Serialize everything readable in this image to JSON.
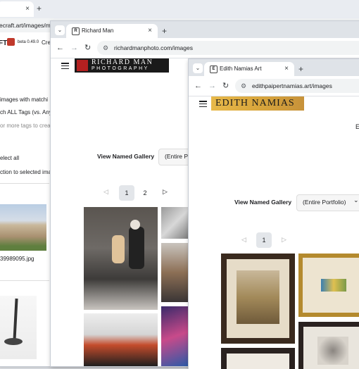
{
  "win1": {
    "tab_close": "×",
    "new_tab": "+",
    "url": "ecraft.art/images/mai",
    "brand": "FT",
    "beta": "beta 0.49.0",
    "create": "Crea",
    "match_text": "images with matchi",
    "all_tags": "ch ALL Tags (vs. Any",
    "more_tags": "or more tags to creat",
    "select_all": "elect all",
    "action": "ction to selected ima",
    "filename": "39989095.jpg"
  },
  "win2": {
    "tab_title": "Richard Man",
    "tab_close": "×",
    "new_tab": "+",
    "url": "richardmanphoto.com/images",
    "logo_line1": "RICHARD MAN",
    "logo_line2": "PHOTOGRAPHY",
    "gallery_label": "View Named Gallery",
    "gallery_value": "(Entire P",
    "pages": [
      "1",
      "2"
    ],
    "prev": "◁",
    "next": "▷"
  },
  "win3": {
    "tab_title": "Edith Namias Art",
    "tab_close": "×",
    "new_tab": "+",
    "url": "edithpaipertnamias.art/images",
    "logo": "EDITH NAMIAS",
    "right_text": "E",
    "gallery_label": "View Named Gallery",
    "gallery_value": "(Entire Portfolio)",
    "gallery_caret": "⌄",
    "pages": [
      "1"
    ],
    "prev": "◁",
    "next": "▷"
  },
  "icons": {
    "back": "←",
    "forward": "→",
    "reload": "↻",
    "menu": "≡",
    "dropdown": "⌄"
  },
  "colors": {
    "accent": "#3d8f77",
    "title_red": "#c0392b",
    "logo_bg": "#1a1a1a",
    "edith_bg": "#e8b94a"
  }
}
